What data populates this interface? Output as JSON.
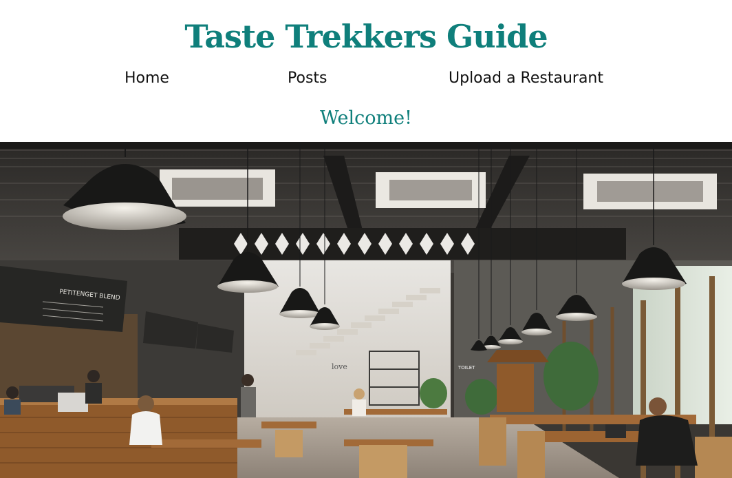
{
  "header": {
    "title": "Taste Trekkers Guide",
    "welcome": "Welcome!"
  },
  "nav": {
    "items": [
      {
        "label": "Home"
      },
      {
        "label": "Posts"
      },
      {
        "label": "Upload a Restaurant"
      }
    ]
  },
  "hero": {
    "description": "cafe-interior-photo",
    "menu_board_text": "PETITENGET BLEND",
    "wall_text": "love",
    "toilet_sign": "TOILET"
  },
  "colors": {
    "accent": "#0f7f7b",
    "nav_text": "#111111",
    "background": "#ffffff"
  }
}
